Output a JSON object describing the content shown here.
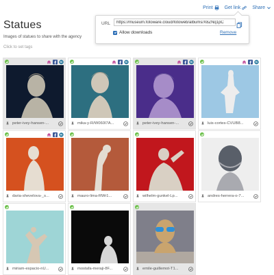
{
  "topbar": {
    "print": "Print",
    "get_link": "Get link",
    "share": "Share"
  },
  "popover": {
    "url_label": "URL",
    "url_value": "https://museum.fotoware.cloud/fotoweb/albums/X8ZNq1pC",
    "allow_downloads": "Allow downloads",
    "remove": "Remove"
  },
  "album": {
    "title": "Statues",
    "description": "Images of statues to share with the agency",
    "tags_placeholder": "Click to set tags"
  },
  "cards": [
    {
      "caption": "peter-ivey-hansen-...",
      "selected": true,
      "share_icons": true,
      "colors": [
        "#0e1a2e",
        "#b8b3a5"
      ]
    },
    {
      "caption": "mika-y-R/W060I7A...",
      "selected": false,
      "share_icons": true,
      "colors": [
        "#2d6f80",
        "#cfc7b8"
      ]
    },
    {
      "caption": "peter-ivey-hansen-...",
      "selected": true,
      "share_icons": true,
      "colors": [
        "#4a2d8a",
        "#a68cc8"
      ]
    },
    {
      "caption": "luis-cortes-CVUB8...",
      "selected": false,
      "share_icons": true,
      "colors": [
        "#9dc8e4",
        "#ededed"
      ]
    },
    {
      "caption": "daria-shevelova-_s...",
      "selected": false,
      "share_icons": true,
      "colors": [
        "#d5511f",
        "#e6ddd1"
      ]
    },
    {
      "caption": "mauro-lima-RWr1...",
      "selected": false,
      "share_icons": false,
      "colors": [
        "#b45a3b",
        "#e3dcd2"
      ]
    },
    {
      "caption": "wilhelm-gunkel-Lp...",
      "selected": false,
      "share_icons": false,
      "colors": [
        "#c1171d",
        "#d9d0c4"
      ]
    },
    {
      "caption": "andres-herrera-o-7...",
      "selected": false,
      "share_icons": false,
      "colors": [
        "#595f69",
        "#a9aab0"
      ]
    },
    {
      "caption": "miriam-espacio-nU...",
      "selected": false,
      "share_icons": false,
      "colors": [
        "#9ed5d6",
        "#d6c7b3"
      ]
    },
    {
      "caption": "mostafa-meraji-8F...",
      "selected": false,
      "share_icons": false,
      "colors": [
        "#0a0a0a",
        "#d7d7d7"
      ]
    },
    {
      "caption": "emile-guillemot-T1...",
      "selected": true,
      "share_icons": false,
      "colors": [
        "#7f7f8a",
        "#c9a46e"
      ]
    }
  ]
}
